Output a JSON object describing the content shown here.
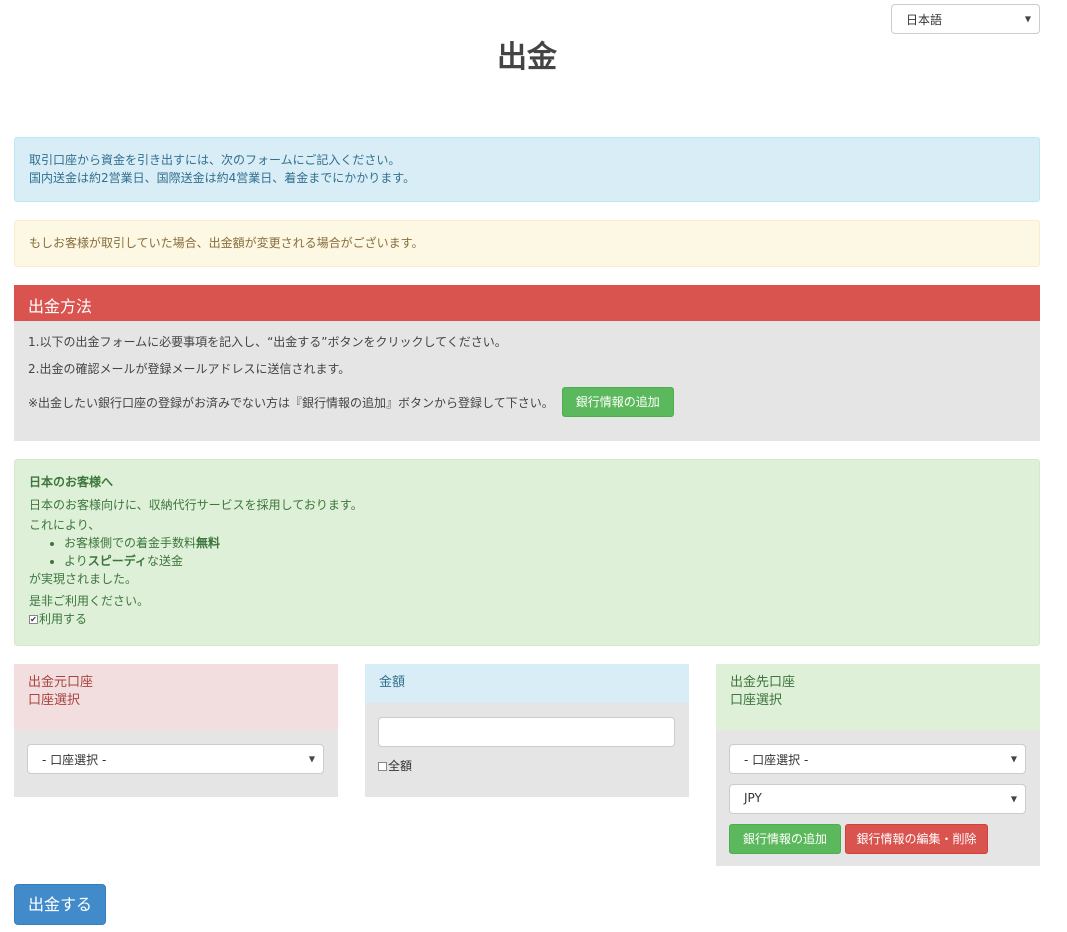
{
  "language": {
    "selected": "日本語"
  },
  "page": {
    "title": "出金"
  },
  "info_alert": {
    "line1": "取引口座から資金を引き出すには、次のフォームにご記入ください。",
    "line2": "国内送金は約2営業日、国際送金は約4営業日、着金までにかかります。"
  },
  "warning_alert": {
    "text": "もしお客様が取引していた場合、出金額が変更される場合がございます。"
  },
  "method": {
    "header": "出金方法",
    "step1": "1.以下の出金フォームに必要事項を記入し、“出金する”ボタンをクリックしてください。",
    "step2": "2.出金の確認メールが登録メールアドレスに送信されます。",
    "note": "※出金したい銀行口座の登録がお済みでない方は『銀行情報の追加』ボタンから登録して下さい。",
    "add_bank_button": "銀行情報の追加"
  },
  "japan_notice": {
    "heading": "日本のお客様へ",
    "line1": "日本のお客様向けに、収納代行サービスを採用しております。",
    "line2": "これにより、",
    "bullet1_prefix": "お客様側での着金手数料",
    "bullet1_bold": "無料",
    "bullet2_prefix": "より",
    "bullet2_bold": "スピーディ",
    "bullet2_suffix": "な送金",
    "line3": "が実現されました。",
    "line4": "是非ご利用ください。",
    "use_label": "利用する",
    "use_checked": true
  },
  "from_panel": {
    "title": "出金元口座",
    "subtitle": "口座選択",
    "select_value": "- 口座選択 -"
  },
  "amount_panel": {
    "title": "金額",
    "amount_value": "",
    "full_amount_label": "全額",
    "full_amount_checked": false
  },
  "to_panel": {
    "title": "出金先口座",
    "subtitle": "口座選択",
    "account_select_value": "- 口座選択 -",
    "currency_select_value": "JPY",
    "add_bank_button": "銀行情報の追加",
    "edit_bank_button": "銀行情報の編集・削除"
  },
  "submit": {
    "label": "出金する"
  },
  "colors": {
    "danger": "#d9534f",
    "success": "#5cb85c",
    "primary": "#428bca",
    "info_bg": "#d9edf7",
    "warning_bg": "#fcf8e3",
    "success_bg": "#dff0d8",
    "danger_bg": "#f2dede"
  }
}
